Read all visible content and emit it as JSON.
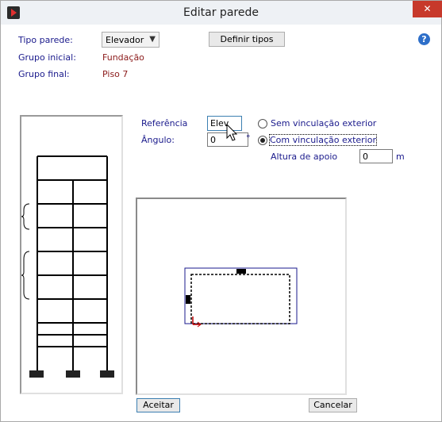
{
  "window": {
    "title": "Editar parede",
    "close_glyph": "✕",
    "icon": "app-play-icon"
  },
  "form": {
    "tipo_parede_label": "Tipo parede:",
    "tipo_parede_value": "Elevador",
    "grupo_inicial_label": "Grupo inicial:",
    "grupo_inicial_value": "Fundação",
    "grupo_final_label": "Grupo final:",
    "grupo_final_value": "Piso 7",
    "definir_tipos_label": "Definir tipos",
    "help_glyph": "?"
  },
  "reference": {
    "referencia_label": "Referência",
    "referencia_value": "Elev",
    "angulo_label": "Ângulo:",
    "angulo_value": "0",
    "angulo_unit": "°",
    "option_sem": "Sem vinculação exterior",
    "option_com": "Com vinculação exterior",
    "selected_option": "Com vinculação exterior",
    "altura_label": "Altura de apoio",
    "altura_value": "0",
    "altura_unit": "m"
  },
  "footer": {
    "aceitar_label": "Aceitar",
    "cancelar_label": "Cancelar"
  },
  "colors": {
    "label": "#1a1a8c",
    "value": "#8b1a1a",
    "close": "#c7392b",
    "help": "#2e6fc9",
    "plan_outline": "#1a1a8c"
  }
}
